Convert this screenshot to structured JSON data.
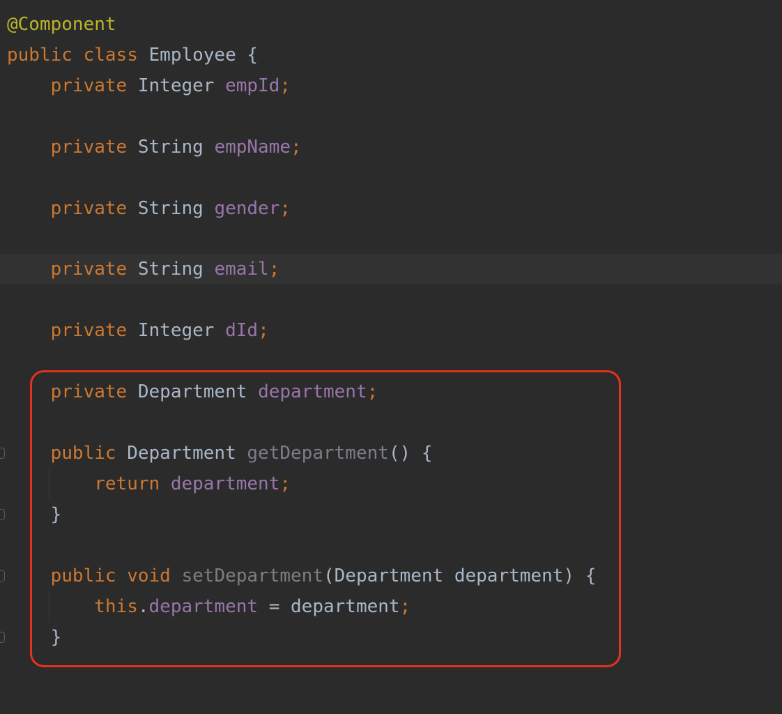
{
  "code": {
    "annotation": "@Component",
    "class_decl": {
      "public": "public",
      "class": "class",
      "name": "Employee",
      "brace": "{"
    },
    "fields": [
      {
        "mod": "private",
        "type": "Integer",
        "name": "empId",
        "semi": ";"
      },
      {
        "mod": "private",
        "type": "String",
        "name": "empName",
        "semi": ";"
      },
      {
        "mod": "private",
        "type": "String",
        "name": "gender",
        "semi": ";"
      },
      {
        "mod": "private",
        "type": "String",
        "name": "email",
        "semi": ";"
      },
      {
        "mod": "private",
        "type": "Integer",
        "name": "dId",
        "semi": ";"
      },
      {
        "mod": "private",
        "type": "Department",
        "name": "department",
        "semi": ";"
      }
    ],
    "getter": {
      "mod": "public",
      "type": "Department",
      "name": "getDepartment",
      "sig": "() {",
      "ret_kw": "return",
      "ret_val": "department",
      "semi": ";",
      "close": "}"
    },
    "setter": {
      "mod": "public",
      "void": "void",
      "name": "setDepartment",
      "open": "(",
      "ptype": "Department",
      "pname": "department",
      "close_sig": ") {",
      "this": "this",
      "dot": ".",
      "field": "department",
      "eq": " = ",
      "val": "department",
      "semi": ";",
      "close": "}"
    }
  },
  "colors": {
    "background": "#2b2b2b",
    "keyword": "#cc7832",
    "annotation": "#bbb529",
    "field": "#9876aa",
    "text": "#a9b7c6",
    "highlight_border": "#e5321f"
  }
}
